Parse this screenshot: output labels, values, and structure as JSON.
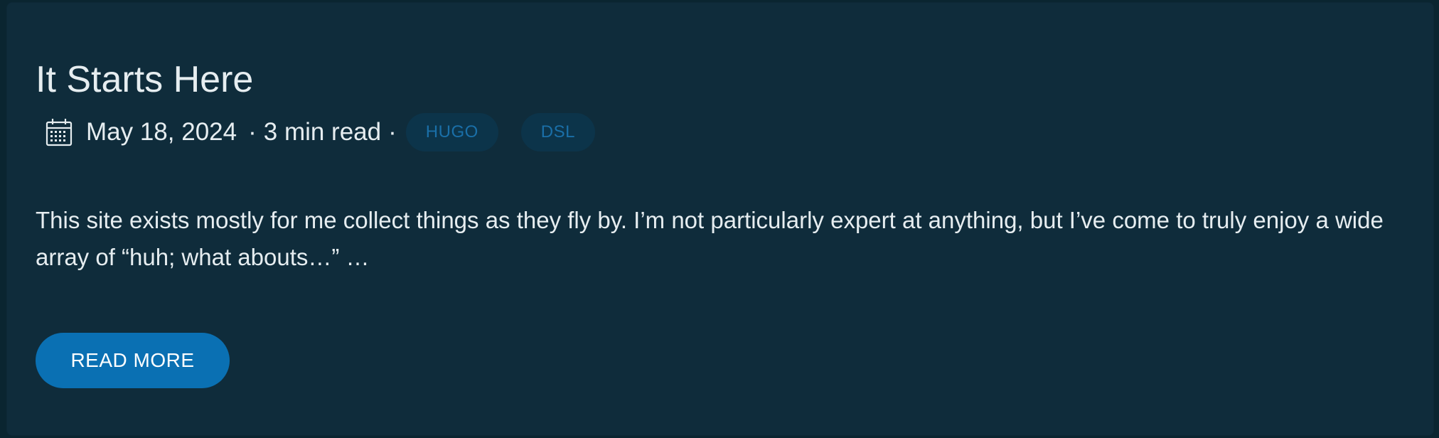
{
  "post": {
    "title": "It Starts Here",
    "date": "May 18, 2024",
    "sep_1": "·",
    "reading_time": "3 min read",
    "sep_2": "·",
    "tags": [
      "HUGO",
      "DSL"
    ],
    "date_icon": "calendar-icon",
    "excerpt": "This site exists mostly for me collect things as they fly by. I’m not particularly expert at anything, but I’ve come to truly enjoy a wide array of “huh; what abouts…” …",
    "read_more_label": "READ MORE"
  },
  "colors": {
    "page_background": "#0a2530",
    "card_background": "#0f2c3b",
    "text": "#e6edf0",
    "tag_background": "#0c344a",
    "tag_text": "#1a6fa8",
    "button_background": "#0a70b3",
    "button_text": "#ffffff"
  }
}
